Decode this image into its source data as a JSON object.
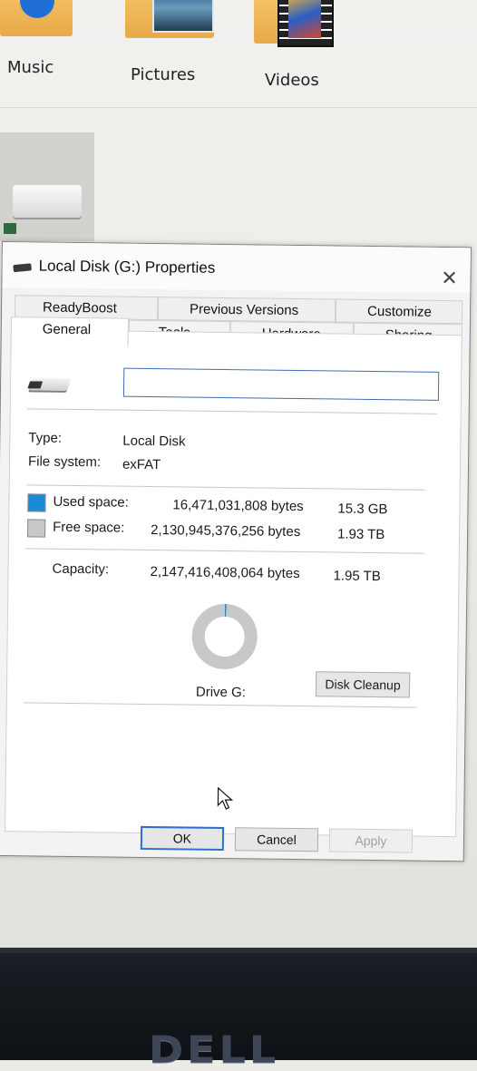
{
  "explorer": {
    "folders": [
      {
        "label": "Music",
        "icon": "music-folder-icon"
      },
      {
        "label": "Pictures",
        "icon": "pictures-folder-icon"
      },
      {
        "label": "Videos",
        "icon": "videos-folder-icon"
      }
    ]
  },
  "dialog": {
    "title": "Local Disk (G:) Properties",
    "close_glyph": "✕",
    "tabs": {
      "readyboost": "ReadyBoost",
      "previous_versions": "Previous Versions",
      "customize": "Customize",
      "general": "General",
      "tools": "Tools",
      "hardware": "Hardware",
      "sharing": "Sharing"
    },
    "active_tab": "General",
    "drive_name_value": "",
    "type_label": "Type:",
    "type_value": "Local Disk",
    "fs_label": "File system:",
    "fs_value": "exFAT",
    "used": {
      "label": "Used space:",
      "bytes": "16,471,031,808 bytes",
      "size": "15.3 GB",
      "color": "#1b8ad7"
    },
    "free": {
      "label": "Free space:",
      "bytes": "2,130,945,376,256 bytes",
      "size": "1.93 TB",
      "color": "#c8c8c8"
    },
    "capacity": {
      "label": "Capacity:",
      "bytes": "2,147,416,408,064 bytes",
      "size": "1.95 TB"
    },
    "used_fraction": 0.0077,
    "drive_label": "Drive G:",
    "disk_cleanup": "Disk Cleanup",
    "buttons": {
      "ok": "OK",
      "cancel": "Cancel",
      "apply": "Apply"
    }
  },
  "monitor": {
    "brand": "DELL"
  }
}
